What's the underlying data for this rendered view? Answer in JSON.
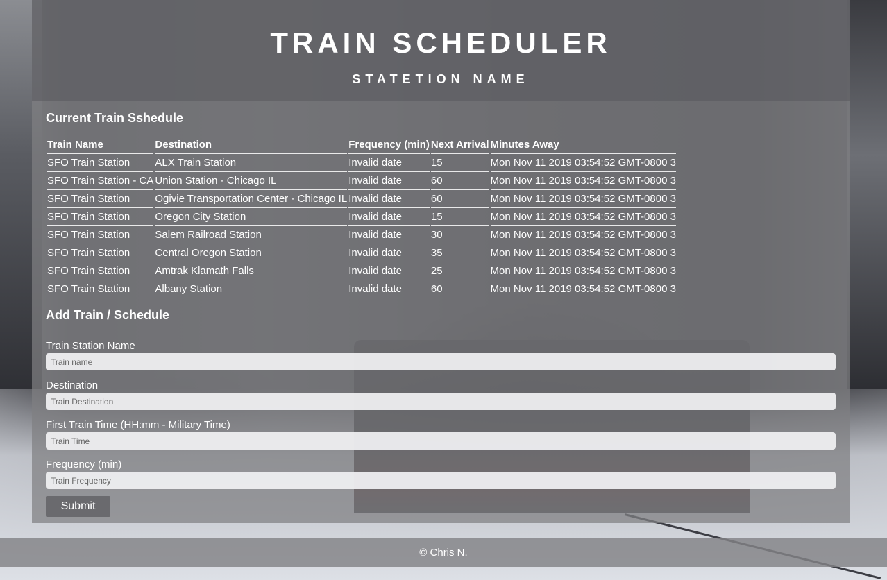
{
  "header": {
    "title": "TRAIN SCHEDULER",
    "subtitle": "STATETION NAME"
  },
  "schedule": {
    "heading": "Current Train Sshedule",
    "columns": [
      "Train Name",
      "Destination",
      "Frequency (min)",
      "Next Arrival",
      "Minutes Away"
    ],
    "rows": [
      [
        "SFO Train Station",
        "ALX Train Station",
        "Invalid date",
        "15",
        "Mon Nov 11 2019 03:54:52 GMT-0800 3"
      ],
      [
        "SFO Train Station - CA",
        "Union Station - Chicago IL",
        "Invalid date",
        "60",
        "Mon Nov 11 2019 03:54:52 GMT-0800 3"
      ],
      [
        "SFO Train Station",
        "Ogivie Transportation Center - Chicago IL",
        "Invalid date",
        "60",
        "Mon Nov 11 2019 03:54:52 GMT-0800 3"
      ],
      [
        "SFO Train Station",
        "Oregon City Station",
        "Invalid date",
        "15",
        "Mon Nov 11 2019 03:54:52 GMT-0800 3"
      ],
      [
        "SFO Train Station",
        "Salem Railroad Station",
        "Invalid date",
        "30",
        "Mon Nov 11 2019 03:54:52 GMT-0800 3"
      ],
      [
        "SFO Train Station",
        "Central Oregon Station",
        "Invalid date",
        "35",
        "Mon Nov 11 2019 03:54:52 GMT-0800 3"
      ],
      [
        "SFO Train Station",
        "Amtrak Klamath Falls",
        "Invalid date",
        "25",
        "Mon Nov 11 2019 03:54:52 GMT-0800 3"
      ],
      [
        "SFO Train Station",
        "Albany Station",
        "Invalid date",
        "60",
        "Mon Nov 11 2019 03:54:52 GMT-0800 3"
      ]
    ]
  },
  "form": {
    "heading": "Add Train / Schedule",
    "fields": [
      {
        "label": "Train Station Name",
        "placeholder": "Train name",
        "value": ""
      },
      {
        "label": "Destination",
        "placeholder": "Train Destination",
        "value": ""
      },
      {
        "label": "First Train Time (HH:mm - Military Time)",
        "placeholder": "Train Time",
        "value": ""
      },
      {
        "label": "Frequency (min)",
        "placeholder": "Train Frequency",
        "value": ""
      }
    ],
    "submit_label": "Submit"
  },
  "footer": {
    "text": "© Chris N."
  }
}
